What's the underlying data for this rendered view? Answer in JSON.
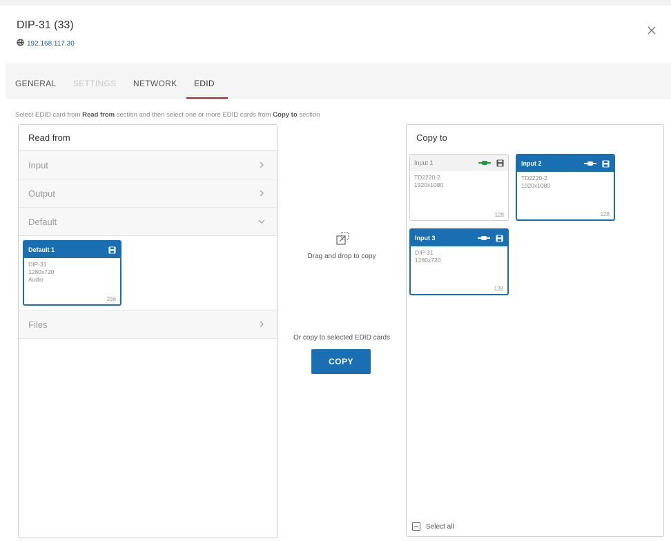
{
  "header": {
    "title": "DIP-31 (33)",
    "ip": "192.168.117.30"
  },
  "tabs": [
    {
      "label": "GENERAL",
      "state": "normal"
    },
    {
      "label": "SETTINGS",
      "state": "disabled"
    },
    {
      "label": "NETWORK",
      "state": "normal"
    },
    {
      "label": "EDID",
      "state": "active"
    }
  ],
  "instructions": {
    "part1": "Select EDID card from ",
    "bold1": "Read from",
    "part2": " section and then select one or more EDID cards from ",
    "bold2": "Copy to",
    "part3": " section"
  },
  "read_from": {
    "title": "Read from",
    "sections": [
      {
        "label": "Input",
        "expanded": false
      },
      {
        "label": "Output",
        "expanded": false
      },
      {
        "label": "Default",
        "expanded": true
      },
      {
        "label": "Files",
        "expanded": false
      }
    ],
    "default_card": {
      "name": "Default 1",
      "lines": [
        "DIP-31",
        "1280x720",
        "Audio"
      ],
      "size": "256",
      "selected": true
    }
  },
  "middle": {
    "drag_text": "Drag and drop to copy",
    "or_text": "Or copy to selected EDID cards",
    "copy_label": "COPY"
  },
  "copy_to": {
    "title": "Copy to",
    "cards": [
      {
        "name": "Input 1",
        "lines": [
          "TD2220-2",
          "1920x1080"
        ],
        "size": "128",
        "selected": false,
        "connector_color": "#1f9a3a"
      },
      {
        "name": "Input 2",
        "lines": [
          "TD2220-2",
          "1920x1080"
        ],
        "size": "128",
        "selected": true,
        "connector_color": "#ffffff"
      },
      {
        "name": "Input 3",
        "lines": [
          "DIP-31",
          "1280x720"
        ],
        "size": "128",
        "selected": true,
        "connector_color": "#ffffff"
      }
    ],
    "select_all": "Select all"
  },
  "colors": {
    "accent": "#1a6fb3",
    "tab_underline": "#b5202d",
    "connected": "#1f9a3a"
  }
}
